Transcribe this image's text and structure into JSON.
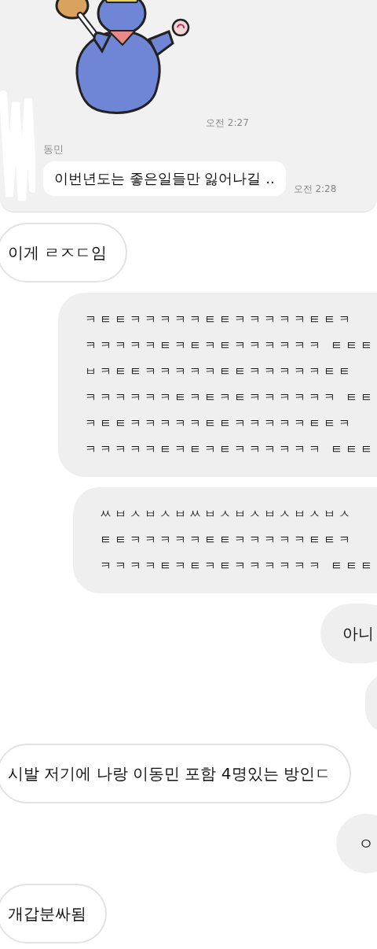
{
  "shared_image": {
    "sticker_time": "오전 2:27",
    "sender": "동민",
    "message": "이번년도는 좋은일들만 잃어나길 ..",
    "message_time": "오전 2:28"
  },
  "messages": [
    {
      "kind": "received",
      "lines": [
        "이게 ㄹㅈㄷ임"
      ]
    },
    {
      "kind": "sent",
      "lines": [
        "ㅋㅌㅌㅋㅋㅋㅋㅋㅌㅌㅋㅋㅋㅋㅋㅌㅌㅋ",
        "ㅋㅋㅋㅋㅋㅌㅋㅌㅋㅌㅋㅋㅋㅋㅋㅋ ㅌㅌㅌ",
        "ㅂㅋㅌㅌㅋㅋㅋㅋㅋㅌㅌㅋㅋㅋㅋㅋㅌㅌ",
        "ㅋㅋㅋㅋㅋㅋㅌㅋㅌㅋㅌㅋㅋㅋㅋㅋㅋ ㅌㅌ",
        "ㅋㅌㅌㅋㅋㅋㅋㅋㅌㅌㅋㅋㅋㅋㅋㅌㅌㅋ",
        "ㅋㅋㅋㅋㅋㅌㅋㅌㅋㅌㅋㅋㅋㅋㅋㅋ ㅌㅌㅌ"
      ]
    },
    {
      "kind": "sent",
      "lines": [
        "ㅆㅂㅅㅂㅅㅂㅆㅂㅅㅂㅅㅂㅅㅂㅅㅂㅅ",
        "ㅌㅌㅋㅋㅋㅋㅋㅌㅌㅋㅋㅋㅋㅋㅌㅌㅋ",
        "ㅋㅋㅋㅋㅌㅋㅌㅋㅌㅋㅋㅋㅋㅋㅋ ㅌㅌㅌ"
      ]
    },
    {
      "kind": "sent",
      "lines": [
        "아니"
      ]
    },
    {
      "kind": "sent"
    },
    {
      "kind": "received",
      "lines": [
        "시발 저기에 나랑 이동민 포함 4명있는 방인ㄷ"
      ]
    },
    {
      "kind": "sent",
      "lines": [
        "ㅇ"
      ]
    },
    {
      "kind": "received",
      "lines": [
        "개갑분싸됨"
      ]
    }
  ]
}
